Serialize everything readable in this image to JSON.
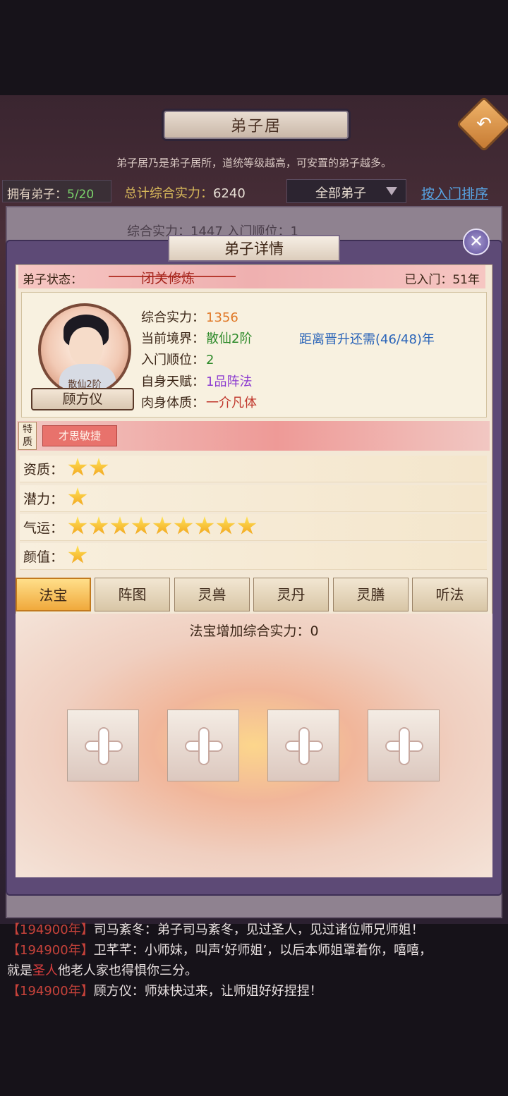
{
  "screen": {
    "title": "弟子居",
    "intro": "弟子居乃是弟子居所，道统等级越高，可安置的弟子越多。",
    "owned_label": "拥有弟子：",
    "owned_value": "5/20",
    "total_label": "总计综合实力：",
    "total_value": "6240",
    "filter_value": "全部弟子",
    "sort_link": "按入门排序",
    "peek_text": "综合实力：1447      入门顺位：1"
  },
  "modal": {
    "title": "弟子详情",
    "close_glyph": "✕",
    "status_label": "弟子状态：",
    "status_value": "闭关修炼",
    "joined": "已入门：51年",
    "disciple": {
      "name": "顾方仪",
      "realm_badge": "散仙2阶",
      "attrs": [
        {
          "label": "综合实力：",
          "value": "1356"
        },
        {
          "label": "当前境界：",
          "value": "散仙2阶"
        },
        {
          "label": "入门顺位：",
          "value": "2"
        },
        {
          "label": "自身天赋：",
          "value": "1品阵法"
        },
        {
          "label": "肉身体质：",
          "value": "一介凡体"
        }
      ],
      "promotion": "距离晋升还需(46/48)年"
    },
    "trait_tag": "特质",
    "trait": "才思敏捷",
    "ratings": [
      {
        "label": "资质：",
        "stars": 2
      },
      {
        "label": "潜力：",
        "stars": 1
      },
      {
        "label": "气运：",
        "stars": 9
      },
      {
        "label": "颜值：",
        "stars": 1
      }
    ],
    "tabs": [
      "法宝",
      "阵图",
      "灵兽",
      "灵丹",
      "灵膳",
      "听法"
    ],
    "active_tab": 0,
    "equip_title": "法宝增加综合实力：0"
  },
  "chat": [
    {
      "time": "【194900年】",
      "speaker": "司马紊冬",
      "text": "：弟子司马紊冬，见过圣人，见过诸位师兄师姐！"
    },
    {
      "time": "【194900年】",
      "speaker": "卫芊芊",
      "text": "：小师妹，叫声‘好师姐’，以后本师姐罩着你，嘻嘻，",
      "cont_pre": "就是",
      "cont_hi": "圣人",
      "cont_post": "他老人家也得惧你三分。"
    },
    {
      "time": "【194900年】",
      "speaker": "顾方仪",
      "text": "：师妹快过来，让师姐好好捏捏！"
    }
  ],
  "colors": {
    "accent_gold": "#f0a93c",
    "link_blue": "#58a6e6",
    "status_red": "#a6261e",
    "star": "#f1a21a"
  },
  "icons": [
    "back-arrow-icon",
    "close-icon",
    "dropdown-triangle-icon",
    "plus-icon",
    "star-icon"
  ]
}
